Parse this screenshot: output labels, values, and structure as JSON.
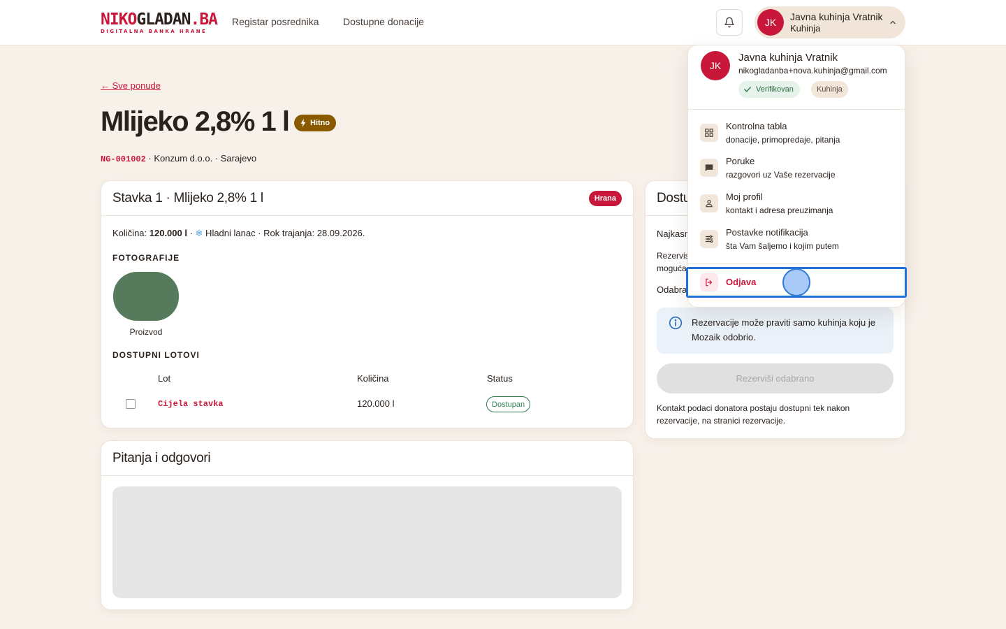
{
  "header": {
    "logo_part1": "NIKO",
    "logo_part2": "GLADAN",
    "logo_part3": ".BA",
    "logo_tagline": "DIGITALNA BANKA HRANE",
    "nav": [
      {
        "label": "Registar posrednika"
      },
      {
        "label": "Dostupne donacije"
      }
    ],
    "user": {
      "initials": "JK",
      "name": "Javna kuhinja Vratnik",
      "role": "Kuhinja"
    }
  },
  "page": {
    "back_link": "← Sve ponude",
    "title": "Mlijeko 2,8% 1 l",
    "urgent_badge": "Hitno",
    "code": "NG-001002",
    "meta_rest": " · Konzum d.o.o. · Sarajevo"
  },
  "item_card": {
    "title": "Stavka 1 · Mlijeko 2,8% 1 l",
    "category": "Hrana",
    "qty_label": "Količina: ",
    "qty_value": "120.000 l",
    "qty_sep": " · ",
    "cold_chain": " Hladni lanac",
    "expiry": " · Rok trajanja: 28.09.2026.",
    "photos_label": "FOTOGRAFIJE",
    "photo_caption": "Proizvod",
    "lots_label": "DOSTUPNI LOTOVI",
    "lots_columns": [
      "Lot",
      "Količina",
      "Status"
    ],
    "lots_rows": [
      {
        "lot": "Cijela stavka",
        "qty": "120.000 l",
        "status": "Dostupan"
      }
    ]
  },
  "qa_card": {
    "title": "Pitanja i odgovori"
  },
  "reservation_card": {
    "title": "Dostu",
    "line1": "Najkasn",
    "line2a": "Rezervis",
    "line2b": "moguća",
    "line3": "Odabra",
    "info": "Rezervacije može praviti samo kuhinja koju je Mozaik odobrio.",
    "button": "Rezerviši odabrano",
    "footnote": "Kontakt podaci donatora postaju dostupni tek nakon rezervacije, na stranici rezervacije."
  },
  "dropdown": {
    "initials": "JK",
    "name": "Javna kuhinja Vratnik",
    "email": "nikogladanba+nova.kuhinja@gmail.com",
    "verified": "Verifikovan",
    "role": "Kuhinja",
    "items": [
      {
        "title": "Kontrolna tabla",
        "subtitle": "donacije, primopredaje, pitanja",
        "icon": "dashboard-icon"
      },
      {
        "title": "Poruke",
        "subtitle": "razgovori uz Vaše rezervacije",
        "icon": "chat-icon"
      },
      {
        "title": "Moj profil",
        "subtitle": "kontakt i adresa preuzimanja",
        "icon": "person-icon"
      },
      {
        "title": "Postavke notifikacija",
        "subtitle": "šta Vam šaljemo i kojim putem",
        "icon": "sliders-icon"
      }
    ],
    "logout": "Odjava"
  },
  "colors": {
    "brand_red": "#c8173a",
    "background": "#f7f1ea",
    "urgent": "#8a5a00",
    "success": "#2e7d4f",
    "focus_blue": "#1e74d6"
  }
}
